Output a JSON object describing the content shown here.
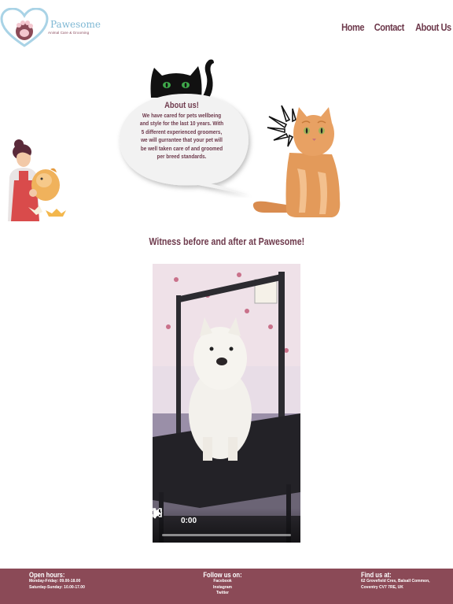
{
  "header": {
    "brand_name": "Pawesome",
    "brand_tagline": "Animal Care & Grooming",
    "nav": [
      "Home",
      "Contact",
      "About Us"
    ]
  },
  "about": {
    "title": "About us!",
    "body": "We have cared for pets wellbeing and style for the last 10 years. With 5 different experienced groomers, we will gurrantee that your pet will be well taken care of and groomed per breed standards."
  },
  "section_title": "Witness before and after at Pawesome!",
  "video": {
    "time": "0:00",
    "progress": 0
  },
  "footer": {
    "hours_title": "Open hours:",
    "hours_lines": [
      "Monday-Friday: 09.00-18.00",
      "Saturday-Sunday: 10.00-17.00"
    ],
    "follow_title": "Follow us on:",
    "follow_lines": [
      "Facebook",
      "Instagram",
      "Twitter"
    ],
    "find_title": "Find us at:",
    "find_lines": [
      "62 Grovefield Cres, Balsall Common,",
      "Coventry CV7 7RE, UK"
    ]
  },
  "colors": {
    "accent": "#6e3a4c",
    "footer_bg": "#8b4a57",
    "brand_blue": "#7fb8d4"
  }
}
